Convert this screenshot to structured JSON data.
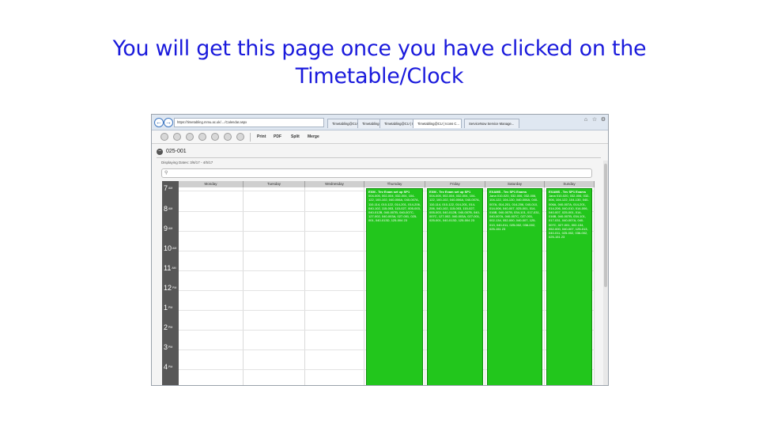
{
  "slide": {
    "title_line1": "You will get this page once you have clicked on the",
    "title_line2": "Timetable/Clock"
  },
  "browser": {
    "address": "https://timetabling.mmu.ac.uk/..../Calendar.aspx",
    "tabs": [
      {
        "label": "Timetabling@CU | Icons Co..."
      },
      {
        "label": "Timetabling@CU | Icons Co..."
      },
      {
        "label": "Timetabling@CU | Icons C..."
      },
      {
        "label": "Timetabling@CU | Icons C..."
      },
      {
        "label": "ServiceNow Service Manage..."
      }
    ],
    "active_tab_index": 3
  },
  "toolbar": {
    "print_label": "Print",
    "pdf_label": "PDF",
    "split_label": "Split",
    "merge_label": "Merge"
  },
  "calendar": {
    "code": "025-001",
    "displaying": "Displaying Dates: 3/6/17 - 4/5/17",
    "days": [
      "Monday",
      "Tuesday",
      "Wednesday",
      "Thursday",
      "Friday",
      "Saturday",
      "Sunday"
    ],
    "hours": [
      {
        "num": "7",
        "suffix": "AM"
      },
      {
        "num": "8",
        "suffix": "AM"
      },
      {
        "num": "9",
        "suffix": "AM"
      },
      {
        "num": "10",
        "suffix": "AM"
      },
      {
        "num": "11",
        "suffix": "AM"
      },
      {
        "num": "12",
        "suffix": "PM"
      },
      {
        "num": "1",
        "suffix": "PM"
      },
      {
        "num": "2",
        "suffix": "PM"
      },
      {
        "num": "3",
        "suffix": "PM"
      },
      {
        "num": "4",
        "suffix": "PM"
      }
    ],
    "events": [
      {
        "day": "Thursday",
        "title": "EXM - Tev Exam set up SP1",
        "body": "004-005, 002-004, 032-004, 104-122, 100-102, 040-006A, 040-007A, 110-114, 010-122, 014-201, 014-206, 040-102, 115-003, 115-027, 005-003, 040-012B, 040-007B, 040-007C, 127-002, 040-003A, 027-001, 025-001, 040-013D, 125-004 23",
        "color": "#22c61c"
      },
      {
        "day": "Friday",
        "title": "EXM - Tev Exam set up SP1",
        "body": "004-005, 002-004, 032-004, 104-122, 100-102, 040-006A, 040-007A, 110-114, 010-122, 014-201, 014-206, 040-102, 115-003, 115-027, 005-003, 040-012B, 040-007B, 040-007C, 127-002, 040-003A, 027-001, 025-001, 040-013D, 125-004 23",
        "color": "#22c61c"
      },
      {
        "day": "Saturday",
        "title": "EXAMS - Tev SP1 Exams",
        "body": "Jana 010-020, 032-006, 032-006, 104-122, 104-130, 040-006A, 040-007A, 014-201, 014-206, 040-010, 014-006, 040-007, 025-001, 014-016B, 040-007B, 034-101, 017-031, 040-007A, 040-007C, 027-001, 002-134, 052-000, 040-007, 125-013, 040-011, 025-002, 036-002, 025-151 23",
        "color": "#22c61c"
      },
      {
        "day": "Sunday",
        "title": "EXAMS - Tev SP1 Exams",
        "body": "Jana 010-020, 032-006, 032-006, 104-122, 104-130, 040-006A, 040-007A, 014-201, 014-206, 040-010, 014-006, 040-007, 025-001, 014-016B, 040-007B, 034-101, 017-031, 040-007A, 040-007C, 027-001, 002-134, 052-000, 040-007, 125-013, 040-011, 025-002, 036-002, 025-151 23",
        "color": "#22c61c"
      }
    ]
  }
}
